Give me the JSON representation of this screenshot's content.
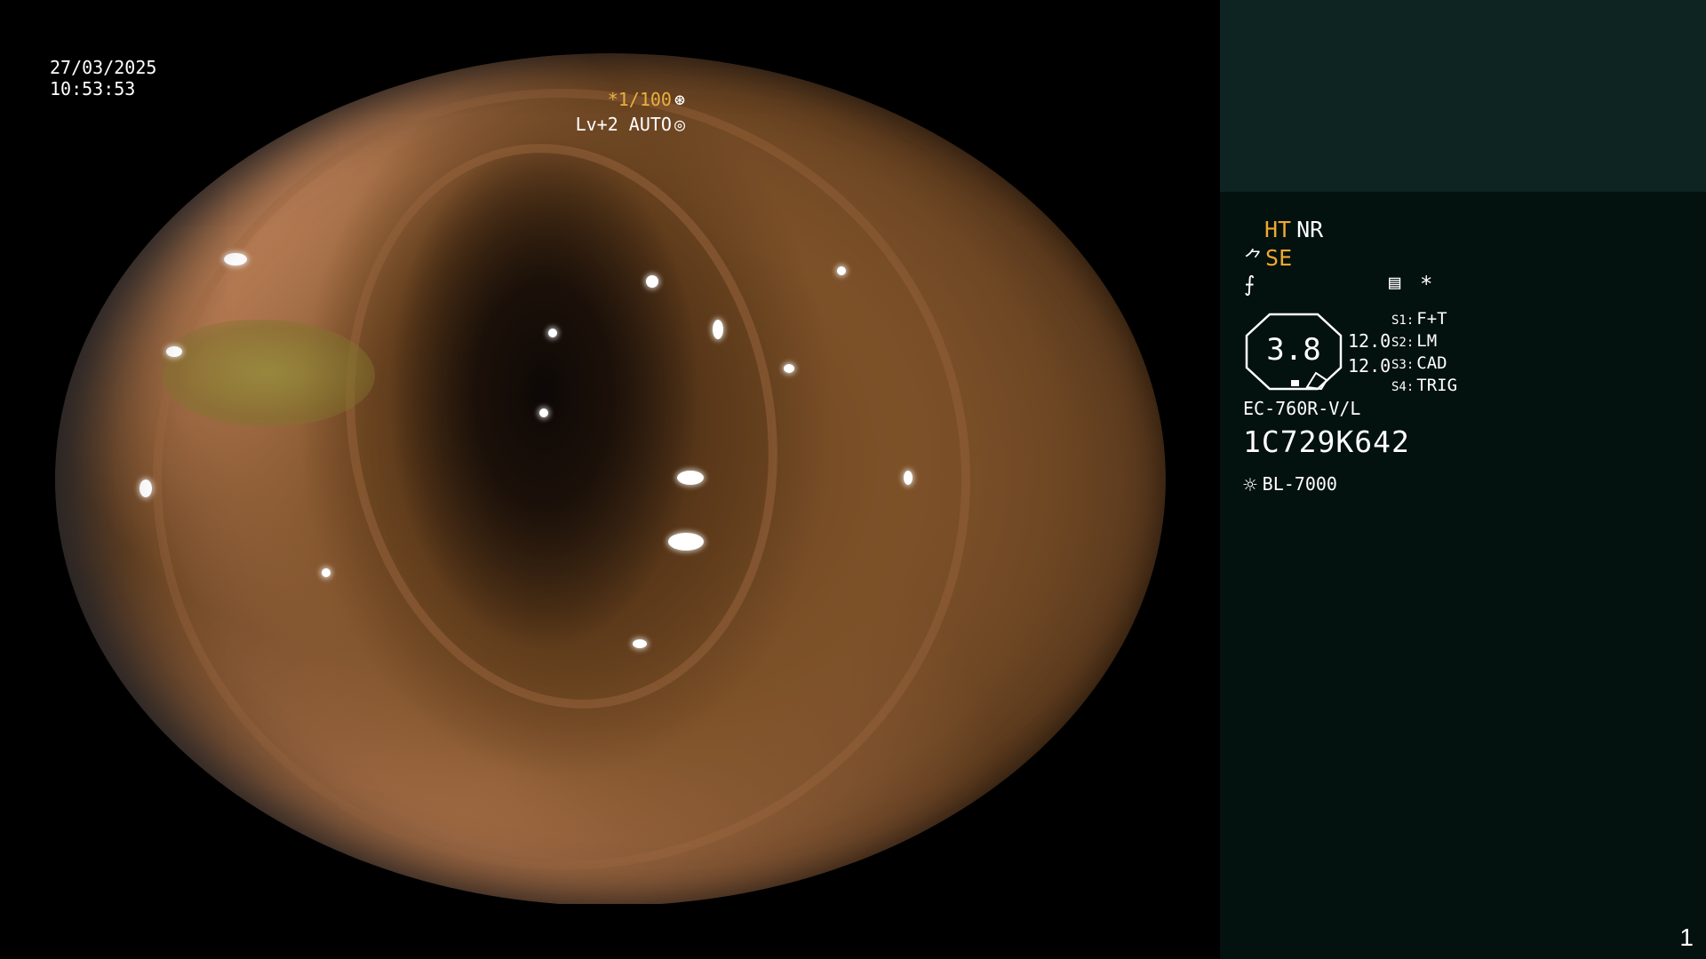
{
  "overlay": {
    "date": "27/03/2025",
    "time": "10:53:53",
    "shutter": "*1/100",
    "shutter_icon": "⊛",
    "level": "Lv+2 AUTO",
    "level_icon": "◎"
  },
  "panel": {
    "ht": "HT",
    "nr": "NR",
    "se_icon": "⺈",
    "se": "SE",
    "f_icon": "⨍",
    "menu_icon": "▤",
    "star": "*",
    "octagon_value": "3.8",
    "value_1": "12.0",
    "value_2": "12.0",
    "switches": [
      {
        "key": "S1:",
        "label": "F+T"
      },
      {
        "key": "S2:",
        "label": "LM"
      },
      {
        "key": "S3:",
        "label": "CAD"
      },
      {
        "key": "S4:",
        "label": "TRIG"
      }
    ],
    "model": "EC-760R-V/L",
    "serial": "1C729K642",
    "light_icon": "☼",
    "light_source": "BL-7000",
    "page_number": "1"
  },
  "colors": {
    "panel_bg": "#03110f",
    "panel_top_bg": "#0d2422",
    "accent_orange": "#f0a830"
  }
}
